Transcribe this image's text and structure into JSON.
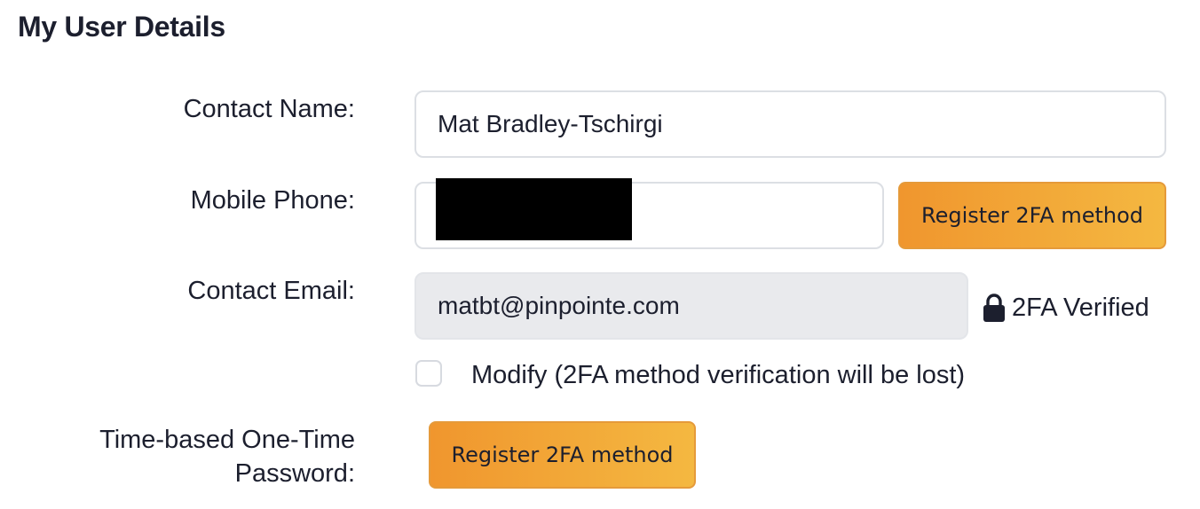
{
  "page": {
    "title": "My User Details"
  },
  "contact_name": {
    "label": "Contact Name:",
    "value": "Mat Bradley-Tschirgi"
  },
  "mobile_phone": {
    "label": "Mobile Phone:",
    "value": "",
    "button_label": "Register 2FA method"
  },
  "contact_email": {
    "label": "Contact Email:",
    "value": "matbt@pinpointe.com",
    "status_label": "2FA Verified",
    "status_icon": "lock-icon"
  },
  "modify": {
    "label": "Modify (2FA method verification will be lost)",
    "checked": false
  },
  "totp": {
    "label_line1": "Time-based One-Time",
    "label_line2": "Password:",
    "button_label": "Register 2FA method"
  },
  "colors": {
    "button_gradient_start": "#f0962e",
    "button_gradient_end": "#f4b841",
    "readonly_field_bg": "#e9eaed",
    "text": "#1c1f2e"
  }
}
